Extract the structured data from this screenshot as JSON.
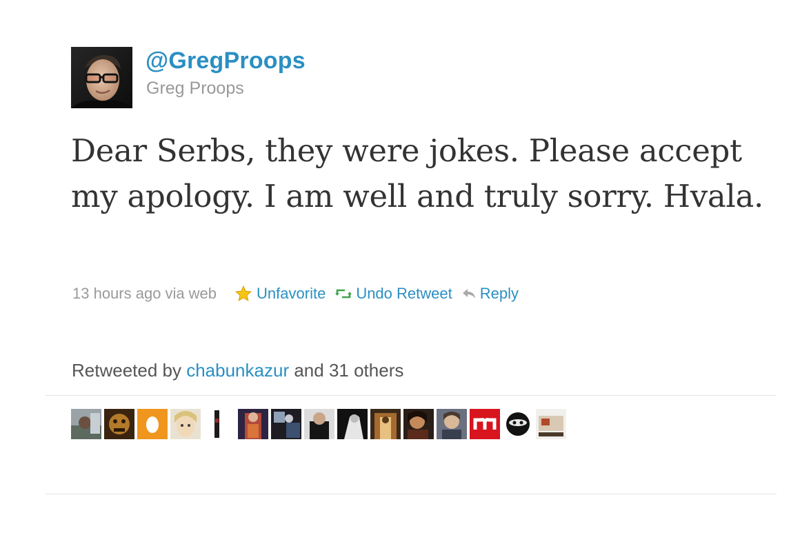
{
  "user": {
    "screen_name": "@GregProops",
    "full_name": "Greg Proops",
    "avatar_icon": "user-avatar-photo"
  },
  "tweet": {
    "text": "Dear Serbs, they were jokes. Please accept my apology. I am well and truly sorry. Hvala."
  },
  "meta": {
    "timestamp": "13 hours ago",
    "via": "via web",
    "actions": {
      "favorite": {
        "label": "Unfavorite",
        "icon": "star-icon",
        "color": "#f5c518"
      },
      "retweet": {
        "label": "Undo Retweet",
        "icon": "retweet-icon",
        "color": "#3fa24a"
      },
      "reply": {
        "label": "Reply",
        "icon": "reply-arrow-icon"
      }
    }
  },
  "retweeted": {
    "prefix": "Retweeted by",
    "user": "chabunkazur",
    "suffix": "and 31 others"
  },
  "colors": {
    "link": "#2a8fc3",
    "muted": "#999999",
    "text": "#333333"
  }
}
